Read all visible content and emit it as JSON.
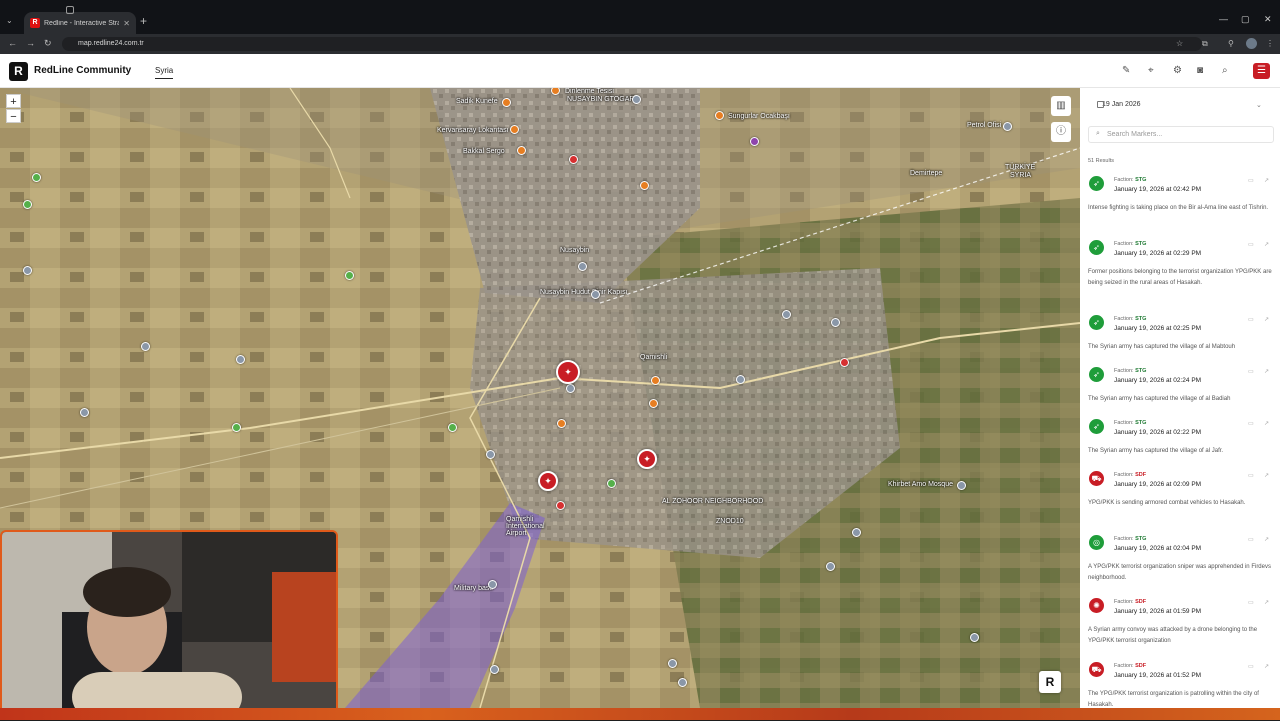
{
  "browser": {
    "tab_title": "Redline - Interactive Strategic M",
    "url": "map.redline24.com.tr"
  },
  "header": {
    "brand": "RedLine Community",
    "logo_letter": "R",
    "region_tab": "Syria"
  },
  "map": {
    "zoom_in": "+",
    "zoom_out": "−",
    "labels": {
      "l1": "Sadik Kunefe",
      "l2": "Dinlenme Tesisi",
      "l3": "NUSAYBIN GTOGAR",
      "l4": "Sungurlar Ocakbaşı",
      "l5": "Kervansaray Lokantası",
      "l6": "Bakkal Sergo",
      "l7": "Nusaybin",
      "l8": "Petrol Ofisi",
      "l9": "Demirtepe",
      "l10": "TÜRKİYE",
      "l11": "SYRIA",
      "l12": "Qamishli",
      "l13": "Qamishli International Airport",
      "l14": "AL ZOHOOR NEIGHBORHOOD",
      "l15": "Khirbet Amo Mosque",
      "l16": "ZNOD10",
      "l17": "Military base",
      "l18": "Nusaybin Hudut Sinir Kapısı"
    },
    "badge_letter": "R"
  },
  "sidebar": {
    "date": "19 Jan 2026",
    "search_placeholder": "Search Markers...",
    "results": "51 Results",
    "items": [
      {
        "faction_label": "Faction:",
        "faction": "STG",
        "date": "January 19, 2026 at 02:42 PM",
        "text": "Intense fighting is taking place on the Bir al-Ama line east of Tishrin."
      },
      {
        "faction_label": "Faction:",
        "faction": "STG",
        "date": "January 19, 2026 at 02:29 PM",
        "text": "Former positions belonging to the terrorist organization YPG/PKK are being seized in the rural areas of Hasakah."
      },
      {
        "faction_label": "Faction:",
        "faction": "STG",
        "date": "January 19, 2026 at 02:25 PM",
        "text": "The Syrian army has captured the village of al Mabtouh"
      },
      {
        "faction_label": "Faction:",
        "faction": "STG",
        "date": "January 19, 2026 at 02:24 PM",
        "text": "The Syrian army has captured the village of al Badiah"
      },
      {
        "faction_label": "Faction:",
        "faction": "STG",
        "date": "January 19, 2026 at 02:22 PM",
        "text": "The Syrian army has captured the village of al Jafr."
      },
      {
        "faction_label": "Faction:",
        "faction": "SDF",
        "date": "January 19, 2026 at 02:09 PM",
        "text": "YPG/PKK is sending armored combat vehicles to Hasakah."
      },
      {
        "faction_label": "Faction:",
        "faction": "STG",
        "date": "January 19, 2026 at 02:04 PM",
        "text": "A YPG/PKK terrorist organization sniper was apprehended in Firdevs neighborhood."
      },
      {
        "faction_label": "Faction:",
        "faction": "SDF",
        "date": "January 19, 2026 at 01:59 PM",
        "text": "A Syrian army convoy was attacked by a drone belonging to the YPG/PKK terrorist organization"
      },
      {
        "faction_label": "Faction:",
        "faction": "SDF",
        "date": "January 19, 2026 at 01:52 PM",
        "text": "The YPG/PKK terrorist organization is patrolling within the city of Hasakah."
      }
    ]
  }
}
